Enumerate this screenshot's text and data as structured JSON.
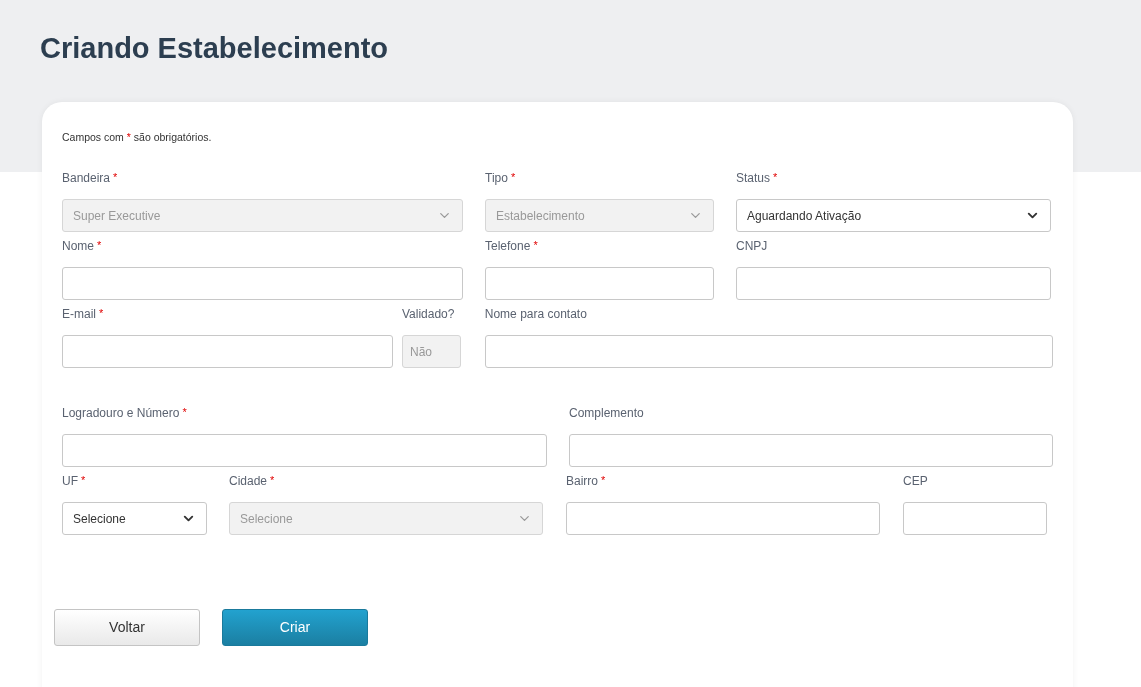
{
  "page_title": "Criando Estabelecimento",
  "required_note": {
    "before": "Campos com",
    "mark": "*",
    "after": "são obrigatórios."
  },
  "form_rows": [
    {
      "fields": [
        {
          "label": "Bandeira",
          "required_mark": "*",
          "kind": "select",
          "value": "Super Executive",
          "disabled": true
        },
        {
          "label": "Tipo",
          "required_mark": "*",
          "kind": "select",
          "value": "Estabelecimento",
          "disabled": true
        },
        {
          "label": "Status",
          "required_mark": "*",
          "kind": "select",
          "value": "Aguardando Ativação",
          "disabled": false
        }
      ]
    },
    {
      "fields": [
        {
          "label": "Nome",
          "required_mark": "*",
          "kind": "text",
          "disabled": false
        },
        {
          "label": "Telefone",
          "required_mark": "*",
          "kind": "text",
          "disabled": false
        },
        {
          "label": "CNPJ",
          "kind": "text",
          "disabled": false
        }
      ]
    },
    {
      "fields": [
        {
          "label": "E-mail",
          "required_mark": "*",
          "kind": "text",
          "disabled": false
        },
        {
          "label": "Validado?",
          "kind": "text",
          "value": "Não",
          "disabled": true
        },
        {
          "label": "Nome para contato",
          "kind": "text",
          "disabled": false
        }
      ]
    },
    {
      "fields": [
        {
          "label": "Logradouro e Número",
          "required_mark": "*",
          "kind": "text",
          "disabled": false
        },
        {
          "label": "Complemento",
          "kind": "text",
          "disabled": false
        }
      ]
    },
    {
      "fields": [
        {
          "label": "UF",
          "required_mark": "*",
          "kind": "select",
          "value": "Selecione",
          "disabled": false
        },
        {
          "label": "Cidade",
          "required_mark": "*",
          "kind": "select",
          "value": "Selecione",
          "disabled": true
        },
        {
          "label": "Bairro",
          "required_mark": "*",
          "kind": "text",
          "disabled": false
        },
        {
          "label": "CEP",
          "kind": "text",
          "disabled": false
        }
      ]
    }
  ],
  "buttons": [
    {
      "label": "Voltar",
      "kind": "secondary"
    },
    {
      "label": "Criar",
      "kind": "primary"
    }
  ]
}
